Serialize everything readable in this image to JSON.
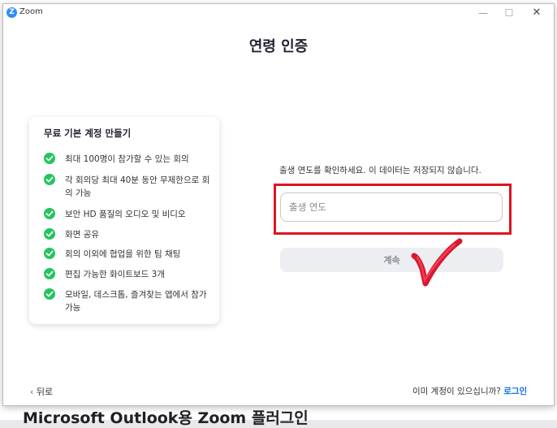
{
  "window": {
    "app_title": "Zoom",
    "app_icon": "zoom-logo-icon",
    "controls": {
      "minimize": "—",
      "maximize": "☐",
      "close": "✕"
    }
  },
  "background": {
    "heading": "Microsoft Outlook용 Zoom 플러그인"
  },
  "page": {
    "title": "연령 인증"
  },
  "card": {
    "title": "무료 기본 계정 만들기",
    "features": [
      "최대 100명이 참가할 수 있는 회의",
      "각 회의당 최대 40분 동안 무제한으로 회의 가능",
      "보안 HD 품질의 오디오 및 비디오",
      "화면 공유",
      "회의 이외에 협업을 위한 팀 채팅",
      "편집 가능한 화이트보드 3개",
      "모바일, 데스크톱, 즐겨찾는 앱에서 참가 가능"
    ],
    "check_color": "#23c55e"
  },
  "form": {
    "instruction": "출생 연도를 확인하세요. 이 데이터는 저장되지 않습니다.",
    "year_placeholder": "출생 연도",
    "year_value": "",
    "continue_label": "계속",
    "highlight_color": "#e0141e"
  },
  "footer": {
    "back_label": "뒤로",
    "account_prompt": "이미 계정이 있으십니까?",
    "login_label": "로그인",
    "link_color": "#0e71eb"
  }
}
